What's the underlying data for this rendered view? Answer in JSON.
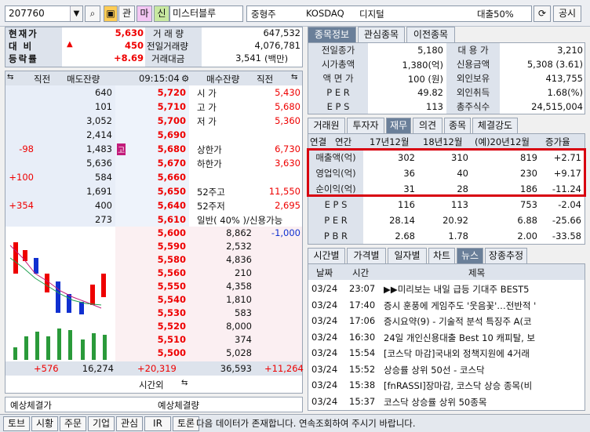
{
  "toolbar": {
    "code": "207760",
    "btn_kwan": "관",
    "btn_ma": "마",
    "btn_sin": "신",
    "stock_name": "미스터블루",
    "market_type": "중형주",
    "exchange": "KOSDAQ",
    "sector": "디지털",
    "loan_ratio": "대출50%",
    "notice": "공시"
  },
  "quote": {
    "cur_label": "현재가",
    "cur_value": "5,630",
    "diff_label": "대 비",
    "diff_value": "450",
    "rate_label": "등락률",
    "rate_value": "+8.69",
    "vol_label": "거 래 량",
    "vol_value": "647,532",
    "prev_vol_label": "전일거래량",
    "prev_vol_value": "4,076,781",
    "amt_label": "거래대금",
    "amt_value": "3,541",
    "amt_unit": "(백만)"
  },
  "orderbook": {
    "col_net": "직전",
    "col_sell": "매도잔량",
    "time": "09:15:04",
    "col_buy": "매수잔량",
    "col_net2": "직전",
    "asks": [
      {
        "net": "",
        "qty": "640",
        "price": "5,720"
      },
      {
        "net": "",
        "qty": "101",
        "price": "5,710"
      },
      {
        "net": "",
        "qty": "3,052",
        "price": "5,700"
      },
      {
        "net": "",
        "qty": "2,414",
        "price": "5,690"
      },
      {
        "net": "-98",
        "qty": "1,483",
        "price": "5,680",
        "mark": "고"
      },
      {
        "net": "",
        "qty": "5,636",
        "price": "5,670"
      },
      {
        "net": "+100",
        "qty": "584",
        "price": "5,660"
      },
      {
        "net": "",
        "qty": "1,691",
        "price": "5,650"
      },
      {
        "net": "+354",
        "qty": "400",
        "price": "5,640"
      },
      {
        "net": "",
        "qty": "273",
        "price": "5,610"
      }
    ],
    "info": [
      {
        "k": "시 가",
        "v": "5,430"
      },
      {
        "k": "고 가",
        "v": "5,680"
      },
      {
        "k": "저 가",
        "v": "5,360"
      },
      {
        "k": "",
        "v": ""
      },
      {
        "k": "상한가",
        "v": "6,730"
      },
      {
        "k": "하한가",
        "v": "3,630"
      },
      {
        "k": "",
        "v": ""
      },
      {
        "k": "52주고",
        "v": "11,550"
      },
      {
        "k": "52주저",
        "v": "2,695"
      },
      {
        "k": "일반( 40% )/신용가능",
        "v": ""
      }
    ],
    "bids": [
      {
        "price": "5,600",
        "qty": "8,862",
        "net": "-1,000"
      },
      {
        "price": "5,590",
        "qty": "2,532",
        "net": ""
      },
      {
        "price": "5,580",
        "qty": "4,836",
        "net": ""
      },
      {
        "price": "5,560",
        "qty": "210",
        "net": ""
      },
      {
        "price": "5,550",
        "qty": "4,358",
        "net": ""
      },
      {
        "price": "5,540",
        "qty": "1,810",
        "net": ""
      },
      {
        "price": "5,530",
        "qty": "583",
        "net": ""
      },
      {
        "price": "5,520",
        "qty": "8,000",
        "net": ""
      },
      {
        "price": "5,510",
        "qty": "374",
        "net": ""
      },
      {
        "price": "5,500",
        "qty": "5,028",
        "net": ""
      }
    ],
    "total_net": "+576",
    "total_sell": "16,274",
    "total_diff": "+20,319",
    "total_buy": "36,593",
    "total_net2": "+11,264",
    "after_hours": "시간외",
    "expect_left": "예상체결가",
    "expect_right": "예상체결량"
  },
  "right_tabs": [
    "종목정보",
    "관심종목",
    "이전종목"
  ],
  "stockinfo": [
    {
      "k": "전일종가",
      "v": "5,180",
      "k2": "대 용 가",
      "v2": "3,210"
    },
    {
      "k": "시가총액",
      "v": "1,380(억)",
      "k2": "신용금액",
      "v2": "5,308  (3.61)"
    },
    {
      "k": "액 면 가",
      "v": "100 (원)",
      "k2": "외인보유",
      "v2": "413,755"
    },
    {
      "k": "P E R",
      "v": "49.82",
      "k2": "외인취득",
      "v2": "1.68(%)"
    },
    {
      "k": "E P S",
      "v": "113",
      "k2": "총주식수",
      "v2": "24,515,004"
    }
  ],
  "fin_tabs": [
    "거래원",
    "투자자",
    "재무",
    "의견",
    "종목",
    "체결강도"
  ],
  "fin": {
    "c0": "연결",
    "c1": "연간",
    "h1": "17년12월",
    "h2": "18년12월",
    "h3": "(예)20년12월",
    "h4": "증가율",
    "rows": [
      {
        "k": "매출액(억)",
        "a": "302",
        "b": "310",
        "c": "819",
        "d": "+2.71"
      },
      {
        "k": "영업익(억)",
        "a": "36",
        "b": "40",
        "c": "230",
        "d": "+9.17"
      },
      {
        "k": "순이익(억)",
        "a": "31",
        "b": "28",
        "c": "186",
        "d": "-11.24"
      },
      {
        "k": "E P S",
        "a": "116",
        "b": "113",
        "c": "753",
        "d": "-2.04"
      },
      {
        "k": "P E R",
        "a": "28.14",
        "b": "20.92",
        "c": "6.88",
        "d": "-25.66"
      },
      {
        "k": "P B R",
        "a": "2.68",
        "b": "1.78",
        "c": "2.00",
        "d": "-33.58"
      }
    ]
  },
  "news_tabs": [
    "시간별",
    "가격별",
    "일자별",
    "차트",
    "뉴스",
    "장종추정"
  ],
  "news": {
    "h_date": "날짜",
    "h_time": "시간",
    "h_title": "제목",
    "items": [
      {
        "d": "03/24",
        "t": "23:07",
        "s": "▶▶미리보는 내일 급등 기대주 BEST5"
      },
      {
        "d": "03/24",
        "t": "17:40",
        "s": "증시 훈풍에 게임주도 '웃음꽃'…전반적 '"
      },
      {
        "d": "03/24",
        "t": "17:06",
        "s": "증시요약(9) - 기술적 분석 특징주 A(코"
      },
      {
        "d": "03/24",
        "t": "16:30",
        "s": "24일 개인신용대출 Best 10 캐피탈, 보"
      },
      {
        "d": "03/24",
        "t": "15:54",
        "s": "[코스닥 마감]국내외 정책지원에 4거래"
      },
      {
        "d": "03/24",
        "t": "15:52",
        "s": "상승률 상위 50선 - 코스닥"
      },
      {
        "d": "03/24",
        "t": "15:38",
        "s": "[fnRASSI]장마감, 코스닥 상승 종목(비"
      },
      {
        "d": "03/24",
        "t": "15:37",
        "s": "코스닥 상승률 상위 50종목"
      }
    ]
  },
  "bottom": {
    "btns": [
      "토",
      "시",
      "주",
      "기",
      "관",
      "IR",
      "토"
    ],
    "labels": [
      "토브",
      "시황",
      "주문",
      "기업",
      "관심",
      "IR",
      "토론"
    ],
    "msg": "다음 데이터가 존재합니다. 연속조회하여 주시기 바랍니다."
  },
  "colors": {
    "up": "#e00000",
    "down": "#1030d0",
    "tab_active": "#6a7f99",
    "highlight": "#d8000f"
  }
}
